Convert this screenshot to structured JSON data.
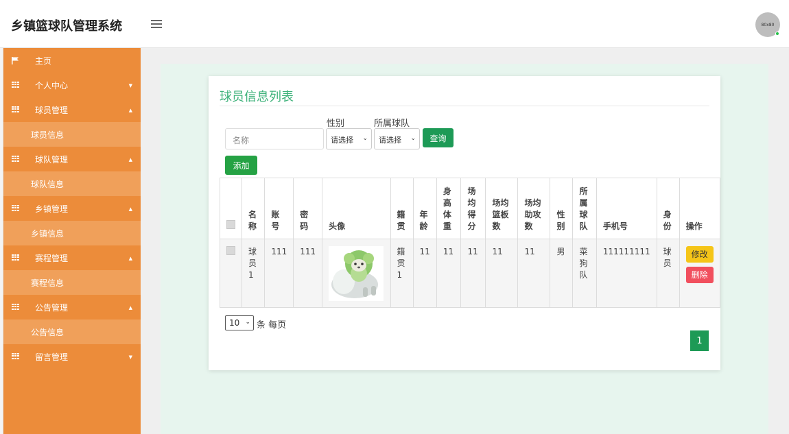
{
  "header": {
    "app_title": "乡镇篮球队管理系统",
    "avatar_text": "80x80"
  },
  "sidebar": {
    "items": [
      {
        "label": "主页",
        "type": "top",
        "icon": "flag-icon"
      },
      {
        "label": "个人中心",
        "type": "top",
        "icon": "grid-icon",
        "caret": "▼"
      },
      {
        "label": "球员管理",
        "type": "top",
        "icon": "grid-icon",
        "caret": "▲"
      },
      {
        "label": "球员信息",
        "type": "sub"
      },
      {
        "label": "球队管理",
        "type": "top",
        "icon": "grid-icon",
        "caret": "▲"
      },
      {
        "label": "球队信息",
        "type": "sub"
      },
      {
        "label": "乡镇管理",
        "type": "top",
        "icon": "grid-icon",
        "caret": "▲"
      },
      {
        "label": "乡镇信息",
        "type": "sub"
      },
      {
        "label": "赛程管理",
        "type": "top",
        "icon": "grid-icon",
        "caret": "▲"
      },
      {
        "label": "赛程信息",
        "type": "sub"
      },
      {
        "label": "公告管理",
        "type": "top",
        "icon": "grid-icon",
        "caret": "▲"
      },
      {
        "label": "公告信息",
        "type": "sub"
      },
      {
        "label": "留言管理",
        "type": "top",
        "icon": "grid-icon",
        "caret": "▼"
      }
    ]
  },
  "main": {
    "title": "球员信息列表",
    "search": {
      "name_placeholder": "名称",
      "gender_label": "性别",
      "gender_value": "请选择",
      "team_label": "所属球队",
      "team_value": "请选择",
      "query_button": "查询"
    },
    "add_button": "添加",
    "table": {
      "headers": [
        "名称",
        "账号",
        "密码",
        "头像",
        "籍贯",
        "年龄",
        "身高体重",
        "场均得分",
        "场均篮板数",
        "场均助攻数",
        "性别",
        "所属球队",
        "手机号",
        "身份",
        "操作"
      ],
      "rows": [
        {
          "name": "球员1",
          "account": "111",
          "password": "111",
          "origin": "籍贯1",
          "age": "11",
          "height_weight": "11",
          "points": "11",
          "rebounds": "11",
          "assists": "11",
          "gender": "男",
          "team": "菜狗队",
          "phone": "111111111",
          "role": "球员",
          "edit_label": "修改",
          "delete_label": "删除"
        }
      ]
    },
    "pagination": {
      "page_size": "10",
      "page_size_suffix": "条 每页",
      "current_page": "1"
    }
  },
  "colors": {
    "sidebar": "#ec8c3a",
    "sidebar_sub": "#f0a05a",
    "accent_green": "#1d9a56",
    "title_green": "#3cb179",
    "edit": "#f5c518",
    "delete": "#f14f5e"
  }
}
